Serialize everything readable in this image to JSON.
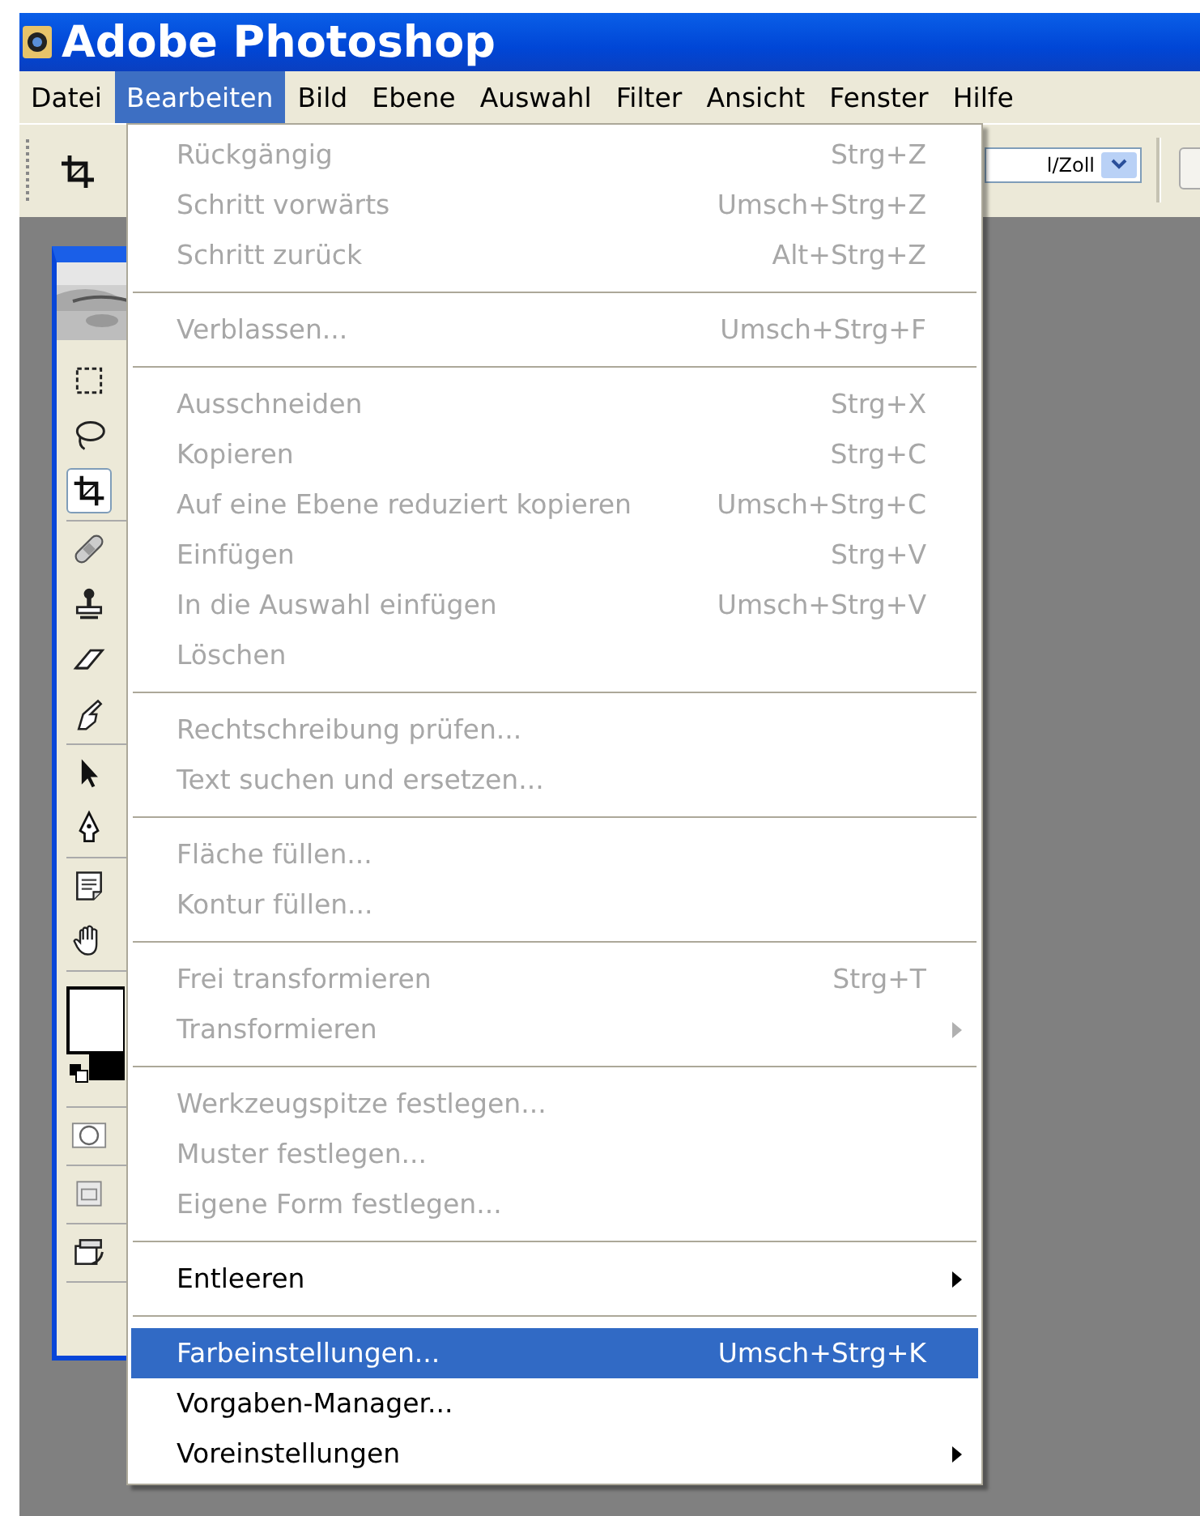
{
  "window": {
    "title": "Adobe Photoshop"
  },
  "menubar": [
    {
      "label": "Datei",
      "selected": false
    },
    {
      "label": "Bearbeiten",
      "selected": true
    },
    {
      "label": "Bild",
      "selected": false
    },
    {
      "label": "Ebene",
      "selected": false
    },
    {
      "label": "Auswahl",
      "selected": false
    },
    {
      "label": "Filter",
      "selected": false
    },
    {
      "label": "Ansicht",
      "selected": false
    },
    {
      "label": "Fenster",
      "selected": false
    },
    {
      "label": "Hilfe",
      "selected": false
    }
  ],
  "toolbar": {
    "unit_field": "l/Zoll"
  },
  "toolbox": {
    "groups": [
      [
        {
          "kind": "marquee",
          "selected": false
        },
        {
          "kind": "lasso",
          "selected": false
        },
        {
          "kind": "crop",
          "selected": true
        }
      ],
      [
        {
          "kind": "bandage",
          "selected": false
        },
        {
          "kind": "stamp",
          "selected": false
        },
        {
          "kind": "eraser",
          "selected": false
        },
        {
          "kind": "smudge",
          "selected": false
        }
      ],
      [
        {
          "kind": "arrow",
          "selected": false
        },
        {
          "kind": "pen",
          "selected": false
        }
      ],
      [
        {
          "kind": "note",
          "selected": false
        },
        {
          "kind": "hand",
          "selected": false
        }
      ],
      [
        {
          "kind": "swatches",
          "selected": false
        }
      ],
      [
        {
          "kind": "quickmask",
          "selected": false
        }
      ],
      [
        {
          "kind": "screenmode",
          "selected": false
        }
      ],
      [
        {
          "kind": "jump",
          "selected": false
        }
      ]
    ]
  },
  "menu": {
    "groups": [
      [
        {
          "label": "Rückgängig",
          "shortcut": "Strg+Z",
          "disabled": true,
          "submenu": false,
          "selected": false
        },
        {
          "label": "Schritt vorwärts",
          "shortcut": "Umsch+Strg+Z",
          "disabled": true,
          "submenu": false,
          "selected": false
        },
        {
          "label": "Schritt zurück",
          "shortcut": "Alt+Strg+Z",
          "disabled": true,
          "submenu": false,
          "selected": false
        }
      ],
      [
        {
          "label": "Verblassen...",
          "shortcut": "Umsch+Strg+F",
          "disabled": true,
          "submenu": false,
          "selected": false
        }
      ],
      [
        {
          "label": "Ausschneiden",
          "shortcut": "Strg+X",
          "disabled": true,
          "submenu": false,
          "selected": false
        },
        {
          "label": "Kopieren",
          "shortcut": "Strg+C",
          "disabled": true,
          "submenu": false,
          "selected": false
        },
        {
          "label": "Auf eine Ebene reduziert kopieren",
          "shortcut": "Umsch+Strg+C",
          "disabled": true,
          "submenu": false,
          "selected": false
        },
        {
          "label": "Einfügen",
          "shortcut": "Strg+V",
          "disabled": true,
          "submenu": false,
          "selected": false
        },
        {
          "label": "In die Auswahl einfügen",
          "shortcut": "Umsch+Strg+V",
          "disabled": true,
          "submenu": false,
          "selected": false
        },
        {
          "label": "Löschen",
          "disabled": true,
          "submenu": false,
          "selected": false
        }
      ],
      [
        {
          "label": "Rechtschreibung prüfen...",
          "disabled": true,
          "submenu": false,
          "selected": false
        },
        {
          "label": "Text suchen und ersetzen...",
          "disabled": true,
          "submenu": false,
          "selected": false
        }
      ],
      [
        {
          "label": "Fläche füllen...",
          "disabled": true,
          "submenu": false,
          "selected": false
        },
        {
          "label": "Kontur füllen...",
          "disabled": true,
          "submenu": false,
          "selected": false
        }
      ],
      [
        {
          "label": "Frei transformieren",
          "shortcut": "Strg+T",
          "disabled": true,
          "submenu": false,
          "selected": false
        },
        {
          "label": "Transformieren",
          "disabled": true,
          "submenu": true,
          "selected": false
        }
      ],
      [
        {
          "label": "Werkzeugspitze festlegen...",
          "disabled": true,
          "submenu": false,
          "selected": false
        },
        {
          "label": "Muster festlegen...",
          "disabled": true,
          "submenu": false,
          "selected": false
        },
        {
          "label": "Eigene Form festlegen...",
          "disabled": true,
          "submenu": false,
          "selected": false
        }
      ],
      [
        {
          "label": "Entleeren",
          "disabled": false,
          "submenu": true,
          "selected": false
        }
      ],
      [
        {
          "label": "Farbeinstellungen...",
          "shortcut": "Umsch+Strg+K",
          "disabled": false,
          "submenu": false,
          "selected": true
        },
        {
          "label": "Vorgaben-Manager...",
          "disabled": false,
          "submenu": false,
          "selected": false
        },
        {
          "label": "Voreinstellungen",
          "disabled": false,
          "submenu": true,
          "selected": false
        }
      ]
    ]
  }
}
